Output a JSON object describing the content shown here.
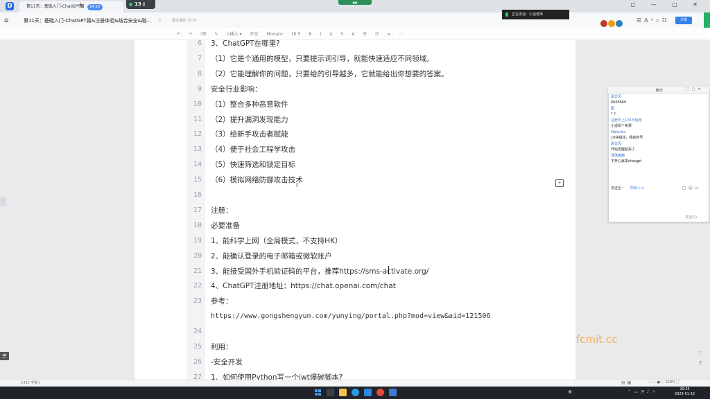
{
  "tabbar": {
    "app_logo": "D",
    "tab_title": "第11天：基础入门-ChatGPT篇",
    "tab_badge": "04:16",
    "meeting_count": "13"
  },
  "window_controls": "◻ — ▢ ✕",
  "docbar": {
    "doc_title": "第11天：基础入门-ChatGPT篇&注册体验&结合安全&融...",
    "saved": "最近保存 15:07",
    "share_label": "分享",
    "speaking": "正在讲话：小迪老师"
  },
  "format_toolbar": [
    "↶",
    "↷",
    "⌫",
    "✎",
    "⊙插入 ▾",
    "正文",
    "Monaco",
    "10.5",
    "B",
    "I",
    "U",
    "S",
    "A",
    "☰",
    "☷",
    "≡",
    "⋯"
  ],
  "document": {
    "lines": [
      {
        "n": "6",
        "text": "3、ChatGPT在哪里?"
      },
      {
        "n": "7",
        "text": "（1）它是个通用的模型，只要提示词引导，就能快速适应不同领域。"
      },
      {
        "n": "8",
        "text": "（2）它能理解你的问题，只要给的引导越多，它就能给出你想要的答案。"
      },
      {
        "n": "9",
        "text": "安全行业影响："
      },
      {
        "n": "10",
        "text": "（1）整合多种恶意软件"
      },
      {
        "n": "11",
        "text": "（2）提升漏洞发现能力"
      },
      {
        "n": "12",
        "text": "（3）给新手攻击者赋能"
      },
      {
        "n": "13",
        "text": "（4）便于社会工程学攻击"
      },
      {
        "n": "14",
        "text": "（5）快速筛选和锁定目标"
      },
      {
        "n": "15",
        "text": "（6）模拟网络防御攻击技术"
      },
      {
        "n": "16",
        "text": ""
      },
      {
        "n": "17",
        "text": "注册："
      },
      {
        "n": "18",
        "text": "必要准备"
      },
      {
        "n": "19",
        "text": "1、能科学上网（全局模式，不支持HK）"
      },
      {
        "n": "20",
        "text": "2、能确认登录的电子邮箱或微软账户"
      },
      {
        "n": "21",
        "text": "3、能接受国外手机验证码的平台，推荐https://sms-activate.org/"
      },
      {
        "n": "22",
        "text": "4、ChatGPT注册地址：https://chat.openai.com/chat"
      },
      {
        "n": "23",
        "text": "参考："
      },
      {
        "n": "",
        "text": "https://www.gongshengyun.com/yunying/portal.php?mod=view&aid=121506"
      },
      {
        "n": "24",
        "text": ""
      },
      {
        "n": "25",
        "text": "利用："
      },
      {
        "n": "26",
        "text": "-安全开发"
      },
      {
        "n": "27",
        "text": "1、如何使用Python写一个jwt爆破脚本?"
      }
    ]
  },
  "chat": {
    "title": "聊天",
    "messages": [
      {
        "name": "夏日风",
        "msg": "6666666"
      },
      {
        "name": "图",
        "msg": "? ?"
      },
      {
        "name": "注册不上126不给用",
        "msg": "小迪哥个免费"
      },
      {
        "name": "Malavita",
        "msg": "10块钱找，我给你号"
      },
      {
        "name": "夏日风",
        "msg": "开始觉醒起来了"
      },
      {
        "name": "球球菌菌",
        "msg": "不开心就来chatgpt"
      }
    ],
    "to_label": "发送至：",
    "to_target": "所有人 ▾",
    "input_hint": "",
    "send_label": "发送(S)"
  },
  "statusbar": {
    "wordcount": "1423 字数 ▾",
    "zoom": "— ──●── 220% ⛶"
  },
  "watermark": "fcmit.cc",
  "taskbar": {
    "time": "20:35",
    "date": "2023-01-12"
  },
  "colors": {
    "accent": "#2f80ed",
    "chat_name": "#3a78d4",
    "watermark": "#f5a142"
  }
}
